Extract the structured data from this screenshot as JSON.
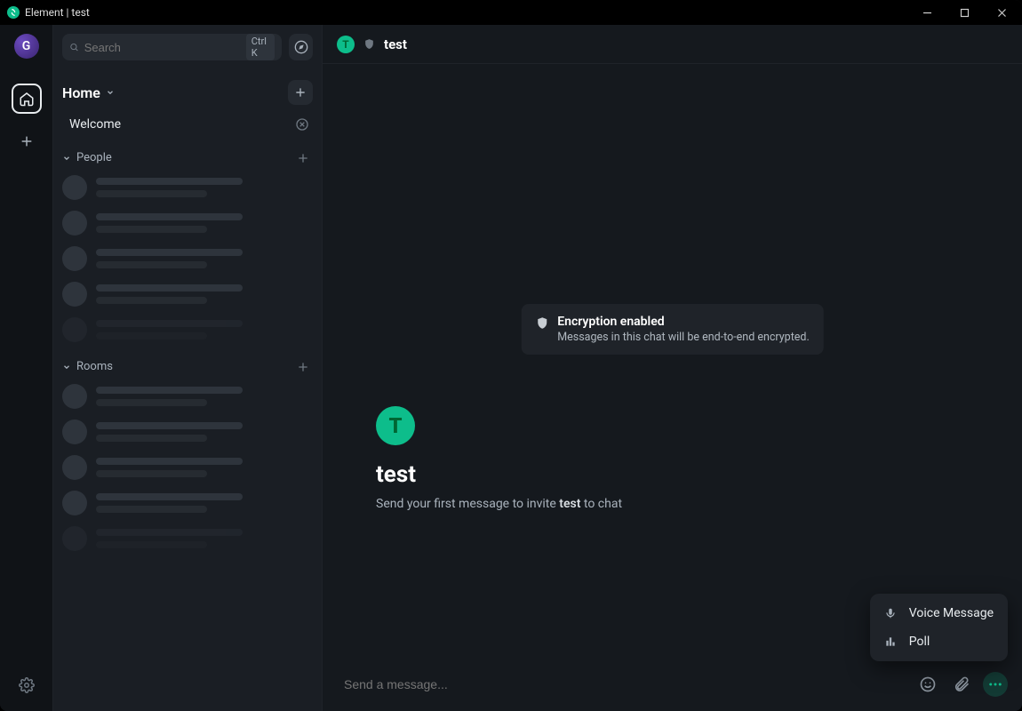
{
  "titlebar": {
    "title": "Element | test"
  },
  "userAvatar": {
    "letter": "G"
  },
  "search": {
    "placeholder": "Search",
    "shortcut": "Ctrl K"
  },
  "spaceHeader": {
    "title": "Home"
  },
  "welcome": {
    "label": "Welcome"
  },
  "sections": {
    "people": "People",
    "rooms": "Rooms"
  },
  "room": {
    "avatarLetter": "T",
    "name": "test",
    "encryption": {
      "title": "Encryption enabled",
      "desc": "Messages in this chat will be end-to-end encrypted."
    },
    "intro": {
      "prefix": "Send your first message to invite ",
      "name": "test",
      "suffix": " to chat"
    }
  },
  "composer": {
    "placeholder": "Send a message..."
  },
  "popup": {
    "voice": "Voice Message",
    "poll": "Poll"
  }
}
